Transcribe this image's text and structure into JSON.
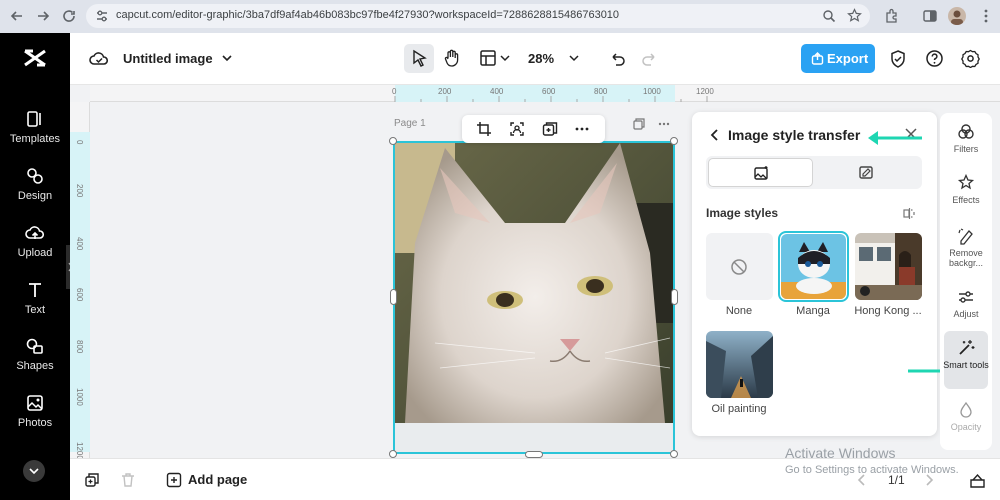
{
  "browser": {
    "url": "capcut.com/editor-graphic/3ba7df9af4ab46b083bc97fbe4f27930?workspaceId=7288628815486763010"
  },
  "sidebar": {
    "items": [
      {
        "label": "Templates",
        "icon": "templates-icon"
      },
      {
        "label": "Design",
        "icon": "design-icon"
      },
      {
        "label": "Upload",
        "icon": "upload-icon"
      },
      {
        "label": "Text",
        "icon": "text-icon"
      },
      {
        "label": "Shapes",
        "icon": "shapes-icon"
      },
      {
        "label": "Photos",
        "icon": "photos-icon"
      }
    ]
  },
  "toolbar": {
    "title": "Untitled image",
    "zoom": "28%",
    "export_label": "Export"
  },
  "ruler": {
    "top_ticks": [
      "0",
      "200",
      "400",
      "600",
      "800",
      "1000",
      "1200"
    ],
    "left_ticks": [
      "0",
      "200",
      "400",
      "600",
      "800",
      "1000",
      "1200"
    ]
  },
  "canvas": {
    "page_label": "Page 1"
  },
  "panel": {
    "title": "Image style transfer",
    "section_heading": "Image styles",
    "styles": [
      {
        "label": "None"
      },
      {
        "label": "Manga"
      },
      {
        "label": "Hong Kong ..."
      },
      {
        "label": "Oil painting"
      }
    ]
  },
  "rail": {
    "items": [
      {
        "label": "Filters"
      },
      {
        "label": "Effects"
      },
      {
        "label": "Remove backgr..."
      },
      {
        "label": "Adjust"
      },
      {
        "label": "Smart tools"
      },
      {
        "label": "Opacity"
      }
    ]
  },
  "bottom": {
    "add_page": "Add page",
    "page_count": "1/1"
  },
  "watermark": {
    "line1": "Activate Windows",
    "line2": "Go to Settings to activate Windows."
  },
  "colors": {
    "accent": "#2bc4d8",
    "export": "#2aa2f3",
    "arrow": "#1ed6b2"
  }
}
